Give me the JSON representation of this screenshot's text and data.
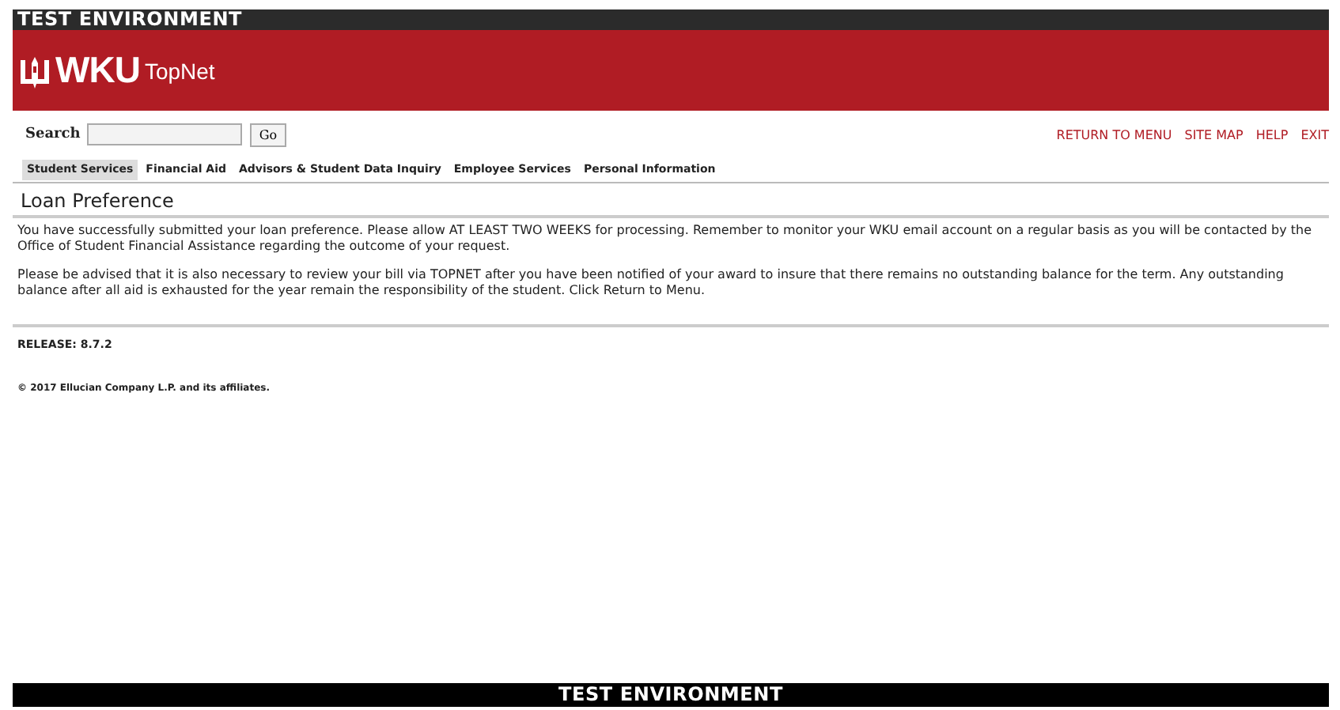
{
  "top_banner": {
    "text": "TEST ENVIRONMENT"
  },
  "header": {
    "logo_text": "WKU",
    "app_name": "TopNet"
  },
  "search": {
    "label": "Search",
    "button": "Go"
  },
  "nav_links": [
    "RETURN TO MENU",
    "SITE MAP",
    "HELP",
    "EXIT"
  ],
  "tabs": [
    {
      "label": "Student Services",
      "selected": true
    },
    {
      "label": "Financial Aid",
      "selected": false
    },
    {
      "label": "Advisors & Student Data Inquiry",
      "selected": false
    },
    {
      "label": "Employee Services",
      "selected": false
    },
    {
      "label": "Personal Information",
      "selected": false
    }
  ],
  "page_title": "Loan Preference",
  "paragraphs": [
    "You have successfully submitted your loan preference. Please allow AT LEAST TWO WEEKS for processing. Remember to monitor your WKU email account on a regular basis as you will be contacted by the Office of Student Financial Assistance regarding the outcome of your request.",
    "Please be advised that it is also necessary to review your bill via TOPNET after you have been notified of your award to insure that there remains no outstanding balance for the term. Any outstanding balance after all aid is exhausted for the year remain the responsibility of the student. Click Return to Menu."
  ],
  "release": "RELEASE: 8.7.2",
  "copyright": "© 2017 Ellucian Company L.P. and its affiliates.",
  "bottom_banner": {
    "text": "TEST ENVIRONMENT"
  }
}
